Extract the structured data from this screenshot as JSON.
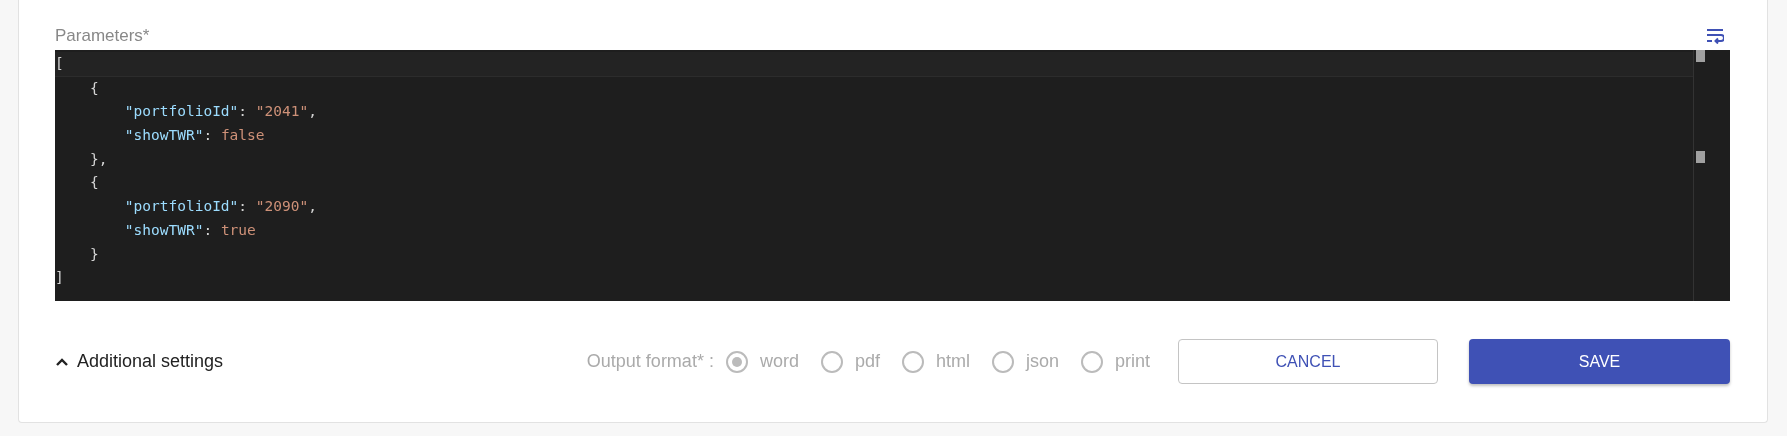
{
  "parameters": {
    "label": "Parameters*",
    "lines": [
      [
        {
          "kind": "punct",
          "text": "["
        }
      ],
      [
        {
          "kind": "punct",
          "text": "    {"
        }
      ],
      [
        {
          "kind": "key",
          "text": "        \"portfolioId\""
        },
        {
          "kind": "punct",
          "text": ": "
        },
        {
          "kind": "string",
          "text": "\"2041\""
        },
        {
          "kind": "punct",
          "text": ","
        }
      ],
      [
        {
          "kind": "key",
          "text": "        \"showTWR\""
        },
        {
          "kind": "punct",
          "text": ": "
        },
        {
          "kind": "literal",
          "text": "false"
        }
      ],
      [
        {
          "kind": "punct",
          "text": "    },"
        }
      ],
      [
        {
          "kind": "punct",
          "text": "    {"
        }
      ],
      [
        {
          "kind": "key",
          "text": "        \"portfolioId\""
        },
        {
          "kind": "punct",
          "text": ": "
        },
        {
          "kind": "string",
          "text": "\"2090\""
        },
        {
          "kind": "punct",
          "text": ","
        }
      ],
      [
        {
          "kind": "key",
          "text": "        \"showTWR\""
        },
        {
          "kind": "punct",
          "text": ": "
        },
        {
          "kind": "literal",
          "text": "true"
        }
      ],
      [
        {
          "kind": "punct",
          "text": "    }"
        }
      ],
      [
        {
          "kind": "punct",
          "text": "]"
        }
      ]
    ]
  },
  "additional_settings": {
    "label": "Additional settings",
    "expanded": true
  },
  "output_format": {
    "label": "Output format* :",
    "options": [
      {
        "label": "word",
        "selected": true
      },
      {
        "label": "pdf",
        "selected": false
      },
      {
        "label": "html",
        "selected": false
      },
      {
        "label": "json",
        "selected": false
      },
      {
        "label": "print",
        "selected": false
      }
    ]
  },
  "buttons": [
    {
      "kind": "outlined",
      "label": "CANCEL"
    },
    {
      "kind": "primary",
      "label": "SAVE"
    }
  ]
}
